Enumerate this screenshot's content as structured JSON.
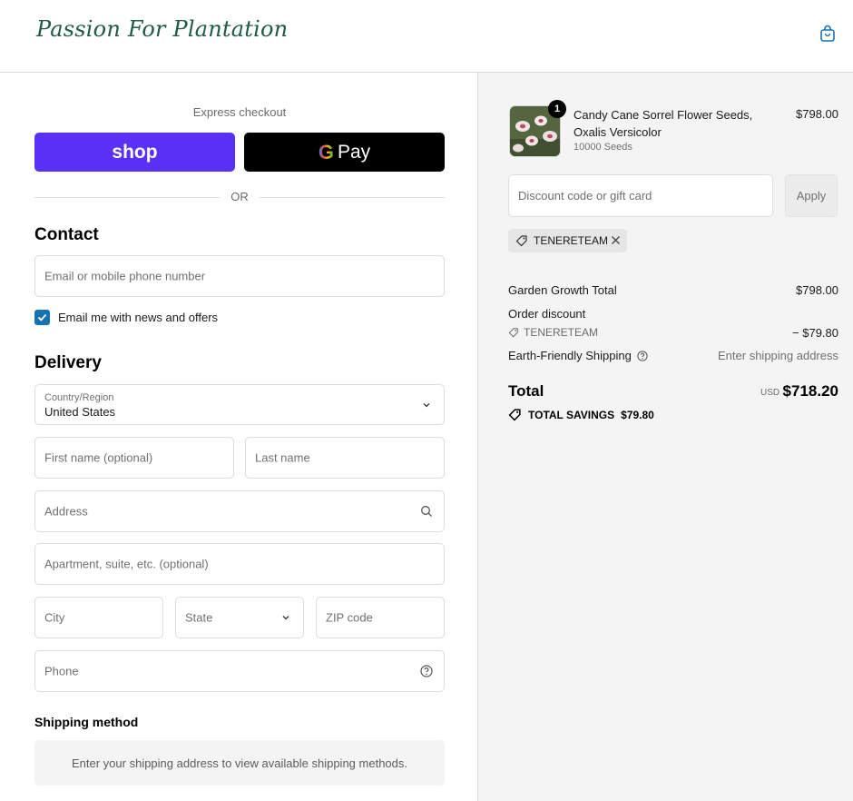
{
  "header": {
    "logo_text": "Passion For Plantation",
    "cart_icon": "shopping-bag-icon"
  },
  "express": {
    "label": "Express checkout",
    "shop_label": "shop",
    "gpay_g": "G",
    "gpay_label": "Pay",
    "or_label": "OR"
  },
  "contact": {
    "heading": "Contact",
    "email_placeholder": "Email or mobile phone number",
    "newsletter_label": "Email me with news and offers",
    "newsletter_checked": true
  },
  "delivery": {
    "heading": "Delivery",
    "country_label": "Country/Region",
    "country_value": "United States",
    "first_name_placeholder": "First name (optional)",
    "last_name_placeholder": "Last name",
    "address_placeholder": "Address",
    "apartment_placeholder": "Apartment, suite, etc. (optional)",
    "city_placeholder": "City",
    "state_placeholder": "State",
    "zip_placeholder": "ZIP code",
    "phone_placeholder": "Phone"
  },
  "shipping_method": {
    "heading": "Shipping method",
    "note": "Enter your shipping address to view available shipping methods."
  },
  "summary": {
    "product": {
      "quantity": "1",
      "title": "Candy Cane Sorrel Flower Seeds, Oxalis Versicolor",
      "variant": "10000 Seeds",
      "price": "$798.00"
    },
    "discount_placeholder": "Discount code or gift card",
    "apply_label": "Apply",
    "applied_code": "TENERETEAM",
    "subtotal_label": "Garden Growth Total",
    "subtotal_value": "$798.00",
    "order_discount_label": "Order discount",
    "discount_code": "TENERETEAM",
    "discount_value": "− $79.80",
    "shipping_label": "Earth-Friendly Shipping",
    "shipping_value": "Enter shipping address",
    "total_label": "Total",
    "total_currency": "USD",
    "total_value": "$718.20",
    "savings_label": "TOTAL SAVINGS",
    "savings_value": "$79.80"
  },
  "colors": {
    "shop_purple": "#5a31f4",
    "checkbox_blue": "#1773b0",
    "logo_green": "#1f5a44"
  }
}
